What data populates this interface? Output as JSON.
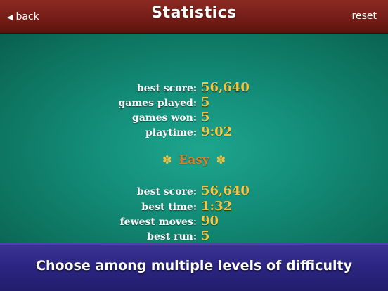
{
  "header": {
    "back_label": "back",
    "title": "Statistics",
    "reset_label": "reset"
  },
  "overall": {
    "best_score_label": "best score:",
    "best_score": "56,640",
    "games_played_label": "games played:",
    "games_played": "5",
    "games_won_label": "games won:",
    "games_won": "5",
    "playtime_label": "playtime:",
    "playtime": "9:02"
  },
  "easy": {
    "heading": "Easy",
    "best_score_label": "best score:",
    "best_score": "56,640",
    "best_time_label": "best time:",
    "best_time": "1:32",
    "fewest_moves_label": "fewest moves:",
    "fewest_moves": "90",
    "best_run_label": "best run:",
    "best_run": "5"
  },
  "icons": {
    "back": "triangle-left-icon",
    "heading_ornament": "club-flower-icon"
  },
  "colors": {
    "header_bg": "#7a1f18",
    "felt": "#14907b",
    "value": "#f4c542",
    "heading": "#d9802c",
    "banner_bg": "#2b2580"
  },
  "banner": {
    "text": "Choose among multiple levels of difficulty"
  }
}
